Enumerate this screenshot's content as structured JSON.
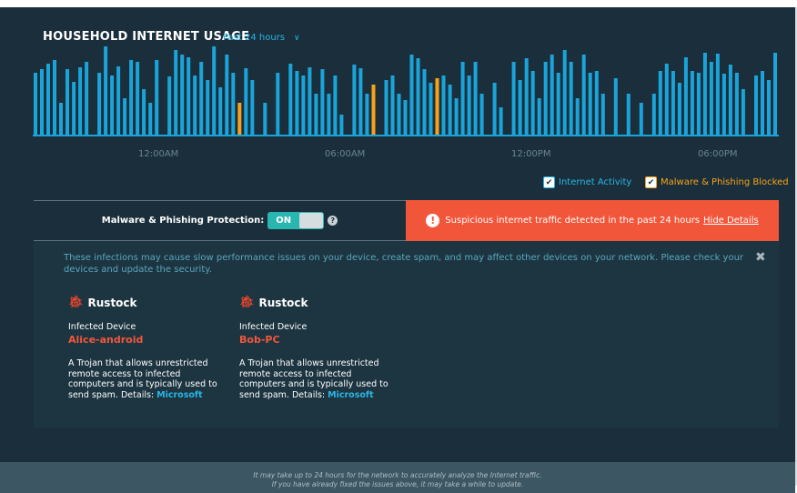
{
  "header": {
    "title": "HOUSEHOLD INTERNET USAGE",
    "range": "Past 24 hours"
  },
  "colors": {
    "activity": "#1ba4d9",
    "malware": "#f7a21b",
    "panel": "#1a2f3b",
    "alert": "#f2563a",
    "toggle": "#2ab6b0"
  },
  "chart_data": {
    "type": "bar",
    "x_ticks": [
      "12:00AM",
      "06:00AM",
      "12:00PM",
      "06:00PM"
    ],
    "series": [
      {
        "name": "Internet Activity",
        "values": [
          68,
          72,
          78,
          82,
          35,
          72,
          58,
          74,
          80,
          0,
          68,
          97,
          65,
          75,
          40,
          82,
          80,
          50,
          35,
          82,
          0,
          64,
          93,
          88,
          85,
          65,
          80,
          60,
          97,
          52,
          88,
          68,
          90,
          73,
          60,
          0,
          35,
          0,
          68,
          0,
          78,
          70,
          65,
          74,
          45,
          72,
          45,
          65,
          22,
          0,
          77,
          73,
          45,
          68,
          0,
          60,
          65,
          45,
          38,
          88,
          84,
          72,
          57,
          83,
          65,
          55,
          40,
          80,
          65,
          80,
          45,
          0,
          57,
          30,
          0,
          80,
          60,
          84,
          70,
          40,
          80,
          88,
          68,
          93,
          80,
          40,
          88,
          68,
          70,
          45,
          0,
          62,
          0,
          45,
          0,
          35,
          0,
          45,
          70,
          78,
          70,
          57,
          85,
          70,
          68,
          90,
          80,
          89,
          67,
          77,
          68,
          50,
          0,
          65,
          70,
          60,
          90
        ]
      },
      {
        "name": "Malware & Phishing Blocked",
        "values": [
          0,
          0,
          0,
          0,
          0,
          0,
          0,
          0,
          0,
          0,
          0,
          0,
          0,
          0,
          0,
          0,
          0,
          0,
          0,
          0,
          0,
          0,
          0,
          0,
          0,
          0,
          0,
          0,
          0,
          0,
          0,
          0,
          0,
          0,
          0,
          0,
          0,
          0,
          0,
          0,
          0,
          0,
          0,
          0,
          0,
          0,
          0,
          0,
          0,
          0,
          0,
          0,
          0,
          0,
          0,
          0,
          0,
          0,
          0,
          0,
          0,
          0,
          0,
          0,
          0,
          0,
          0,
          0,
          0,
          0,
          0,
          0,
          0,
          0,
          0,
          0,
          0,
          0,
          0,
          0,
          0,
          0,
          0,
          0,
          0,
          0,
          0,
          0,
          0,
          0,
          0,
          0,
          0,
          0,
          0,
          0,
          0,
          0,
          0,
          0,
          0,
          0,
          0,
          0,
          0,
          0,
          0,
          0,
          0,
          0,
          0,
          0,
          0,
          0,
          0,
          0,
          0
        ]
      }
    ],
    "malware_events": [
      {
        "index": 32,
        "value": 35
      },
      {
        "index": 53,
        "value": 55
      },
      {
        "index": 63,
        "value": 62
      }
    ],
    "ylim": [
      0,
      100
    ]
  },
  "legend": {
    "activity": "Internet Activity",
    "malware": "Malware & Phishing Blocked"
  },
  "protection": {
    "label": "Malware & Phishing Protection:",
    "toggle": "ON",
    "help": "?"
  },
  "alert": {
    "message": "Suspicious internet traffic detected in the past 24 hours",
    "link": "Hide Details",
    "icon": "!"
  },
  "details": {
    "intro": "These infections may cause slow performance issues on your device, create spam, and may affect other devices on your network. Please check your devices and update the security.",
    "close": "✖",
    "infections": [
      {
        "name": "Rustock",
        "device_label": "Infected Device",
        "device": "Alice-android",
        "description": "A Trojan that allows unrestricted remote access to infected computers and is typically used to send spam.",
        "details_label": "Details:",
        "details_link": "Microsoft"
      },
      {
        "name": "Rustock",
        "device_label": "Infected Device",
        "device": "Bob-PC",
        "description": "A Trojan that allows unrestricted remote access to infected computers and is typically used to send spam.",
        "details_label": "Details:",
        "details_link": "Microsoft"
      }
    ]
  },
  "footer": {
    "line1": "It may take up to 24 hours for the network to accurately analyze the Internet traffic.",
    "line2": "If you have already fixed the issues above, it may take a while to update."
  }
}
